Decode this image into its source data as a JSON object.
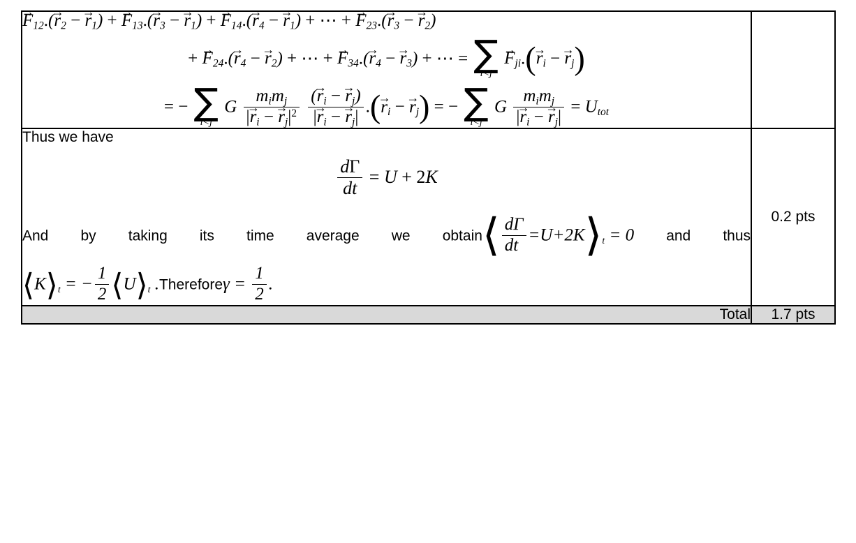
{
  "document": {
    "type": "grading-rubric-table",
    "background_color": "#ffffff",
    "border_color": "#000000",
    "total_row_fill": "#d9d9d9"
  },
  "rows": [
    {
      "id": "derivation-row",
      "points": "",
      "equation_lines": [
        "F⃗₁₂.(r⃗₂ − r⃗₁) + F⃗₁₃.(r⃗₃ − r⃗₁) + F⃗₁₄.(r⃗₄ − r⃗₁) + ⋯ + F⃗₂₃.(r⃗₃ − r⃗₂)",
        "+ F⃗₂₄.(r⃗₄ − r⃗₂) + ⋯ + F⃗₃₄.(r⃗₄ − r⃗₃) + ⋯ = Σ_{i<j} F⃗_{ji}.(r⃗_i − r⃗_j)",
        "= − Σ_{i<j} G (m_i m_j / |r⃗_i − r⃗_j|²)((r⃗_i − r⃗_j)/|r⃗_i − r⃗_j|).(r⃗_i − r⃗_j) = − Σ_{i<j} G m_i m_j/|r⃗_i − r⃗_j| = U_tot"
      ]
    },
    {
      "id": "conclusion-row",
      "points": "0.2 pts",
      "intro_text": "Thus we have",
      "display_equation": "dΓ/dt = U + 2K",
      "sentence_part_1": "And",
      "sentence_part_2": "by",
      "sentence_part_3": "taking",
      "sentence_part_4": "its",
      "sentence_part_5": "time",
      "sentence_part_6": "average",
      "sentence_part_7": "we",
      "sentence_part_8": "obtain",
      "inline_equation": "⟨dΓ/dt = U + 2K⟩_t = 0",
      "sentence_part_9": "and",
      "sentence_part_10": "thus",
      "final_equation_left": "⟨K⟩_t = −(1/2)⟨U⟩_t .",
      "final_text": "Therefore",
      "final_equation_right": "γ = 1/2 ."
    }
  ],
  "total_row": {
    "label": "Total",
    "points": "1.7 pts"
  },
  "symbols": {
    "vector_arrow": "⃗",
    "sigma": "∑",
    "gamma_capital": "Γ",
    "gamma_lower": "γ",
    "minus": "−",
    "ellipsis": "⋯",
    "langle": "⟨",
    "rangle": "⟩",
    "less_than": "<",
    "equals": "=",
    "plus": "+",
    "dot": "."
  },
  "math_tokens": {
    "F": "F",
    "r": "r",
    "m": "m",
    "G": "G",
    "U": "U",
    "K": "K",
    "d": "d",
    "t": "t",
    "i": "i",
    "j": "j",
    "one": "1",
    "two": "2",
    "three": "3",
    "four": "4",
    "zero": "0",
    "twelve": "12",
    "thirteen": "13",
    "fourteen": "14",
    "twentythree": "23",
    "twentyfour": "24",
    "thirtyfour": "34",
    "ji": "ji",
    "Utot": "U",
    "tot": "tot",
    "ilessj": "i<j",
    "sq": "2"
  }
}
